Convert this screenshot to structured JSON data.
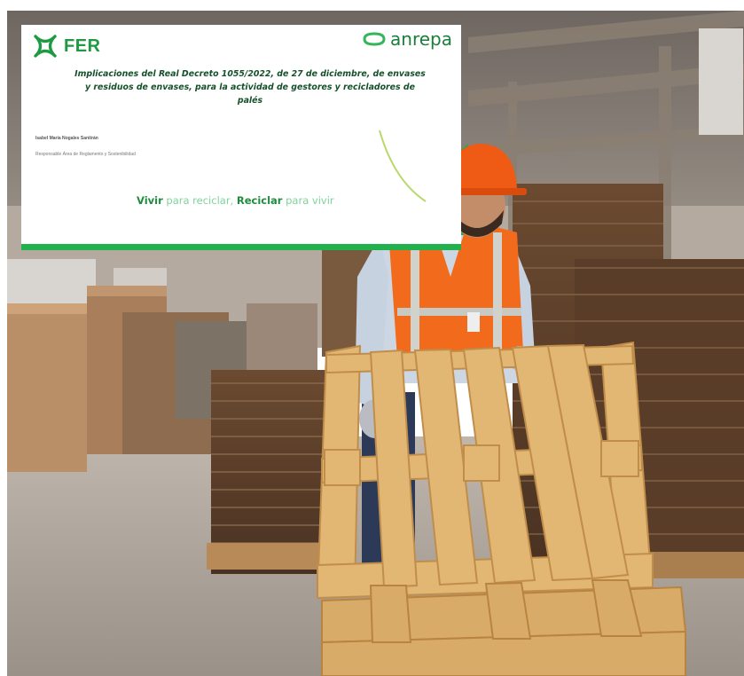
{
  "slide": {
    "brand_left": "FER",
    "brand_right": "anrepa",
    "title": "Implicaciones del Real Decreto 1055/2022, de 27 de diciembre, de envases y residuos de envases, para la actividad de gestores y recicladores de palés",
    "author": "Isabel María Nogales Santirán",
    "role": "Responsable Área de Reglamento y Sostenibilidad",
    "slogan_1": "Vivir",
    "slogan_2": " para reciclar, ",
    "slogan_3": "Reciclar",
    "slogan_4": " para vivir"
  },
  "colors": {
    "brand_green": "#1e9a43",
    "bar_green": "#22b14c",
    "vest_orange": "#f26a1b",
    "helmet_orange": "#ef5a14",
    "pallet_wood": "#e2b673"
  },
  "icons": [
    "fer-logo-icon",
    "anrepa-logo-icon"
  ]
}
